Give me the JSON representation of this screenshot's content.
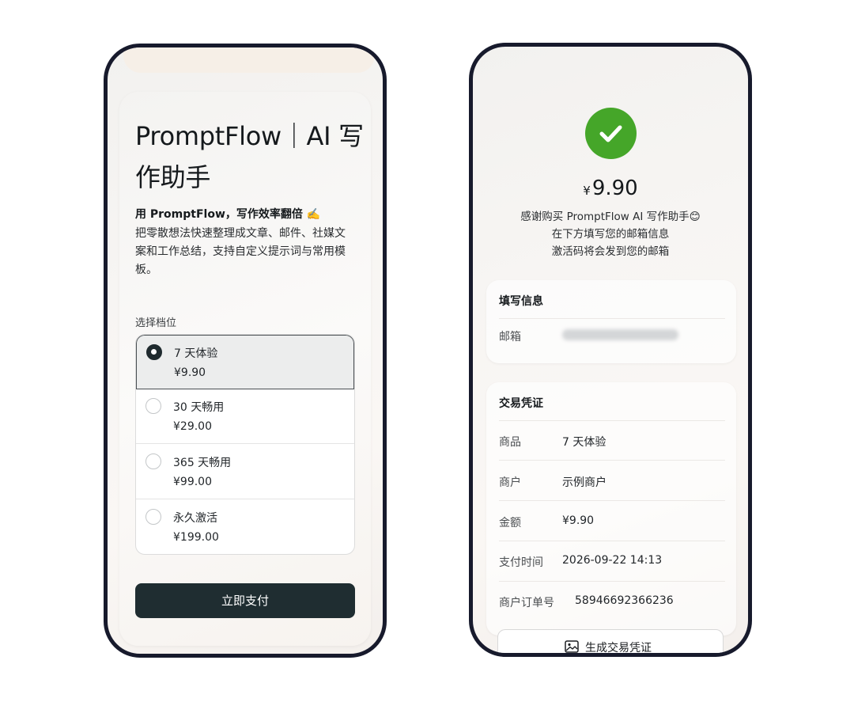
{
  "left": {
    "title": "PromptFlow｜AI 写作助手",
    "subtitle": "用 PromptFlow，写作效率翻倍 ✍️",
    "description": "把零散想法快速整理成文章、邮件、社媒文案和工作总结，支持自定义提示词与常用模板。",
    "plan_label": "选择档位",
    "plans": [
      {
        "name": "7 天体验",
        "price": "¥9.90",
        "selected": true
      },
      {
        "name": "30 天畅用",
        "price": "¥29.00",
        "selected": false
      },
      {
        "name": "365 天畅用",
        "price": "¥99.00",
        "selected": false
      },
      {
        "name": "永久激活",
        "price": "¥199.00",
        "selected": false
      }
    ],
    "pay_button": "立即支付"
  },
  "right": {
    "currency": "¥",
    "amount": "9.90",
    "thanks_lines": [
      "感谢购买 PromptFlow AI 写作助手😊",
      "在下方填写您的邮箱信息",
      "激活码将会发到您的邮箱"
    ],
    "info_card": {
      "title": "填写信息",
      "email_label": "邮箱"
    },
    "receipt_card": {
      "title": "交易凭证",
      "rows": [
        {
          "label": "商品",
          "value": "7 天体验"
        },
        {
          "label": "商户",
          "value": "示例商户"
        },
        {
          "label": "金额",
          "value": "¥9.90"
        },
        {
          "label": "支付时间",
          "value": "2026-09-22 14:13"
        },
        {
          "label": "商户订单号",
          "value": "58946692366236"
        }
      ]
    },
    "generate_button": "生成交易凭证"
  },
  "colors": {
    "accent": "#1f2d31",
    "success": "#45a629",
    "frame": "#171a2c"
  },
  "icons": [
    "checkmark-icon",
    "image-icon"
  ]
}
